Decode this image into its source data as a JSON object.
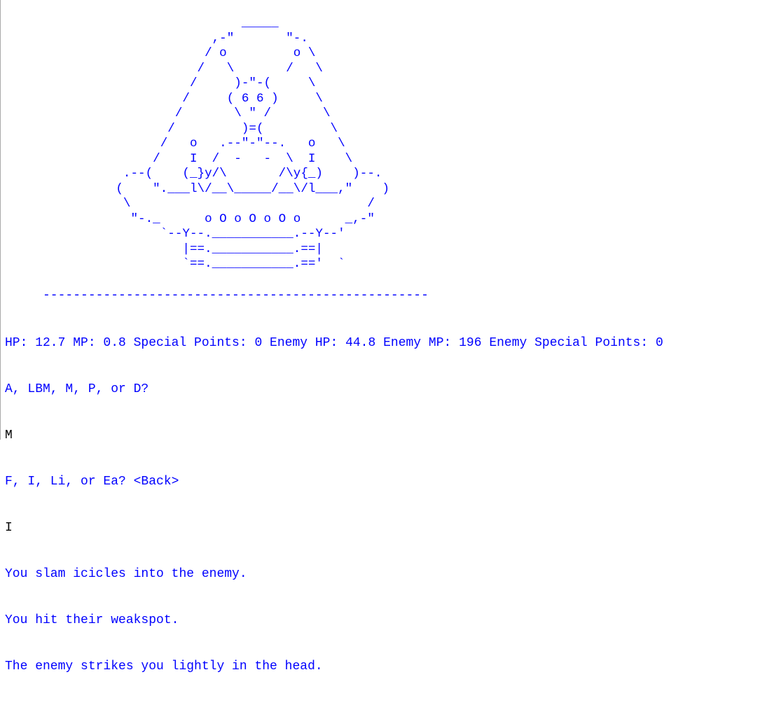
{
  "colors": {
    "output_text": "#0000ff",
    "input_text": "#000000",
    "background": "#ffffff",
    "border": "#a9a9a9"
  },
  "ascii_art": "                                _____\n                            ,-\"       \"-.\n                           / o         o \\\n                          /   \\       /   \\\n                         /     )-\"-(     \\\n                        /     ( 6 6 )     \\\n                       /       \\ \" /       \\\n                      /         )=(         \\\n                     /   o   .--\"-\"--.   o   \\\n                    /    I  /  -   -  \\  I    \\\n                .--(    (_}y/\\       /\\y{_)    )--.\n               (    \".___l\\/__\\_____/__\\/l___,\"    )\n                \\                                /\n                 \"-._      o O o O o O o      _,-\"\n                     `--Y--.___________.--Y--'\n                        |==.___________.==|\n                        `==.___________.=='  `",
  "separator": "     ---------------------------------------------------",
  "status_line": "HP: 12.7 MP: 0.8 Special Points: 0 Enemy HP: 44.8 Enemy MP: 196 Enemy Special Points: 0",
  "prompt_action": "A, LBM, M, P, or D?",
  "input_action": "M",
  "prompt_spell": "F, I, Li, or Ea? <Back>",
  "input_spell": "I",
  "messages": [
    "You slam icicles into the enemy.",
    "You hit their weakspot.",
    "The enemy strikes you lightly in the head."
  ]
}
